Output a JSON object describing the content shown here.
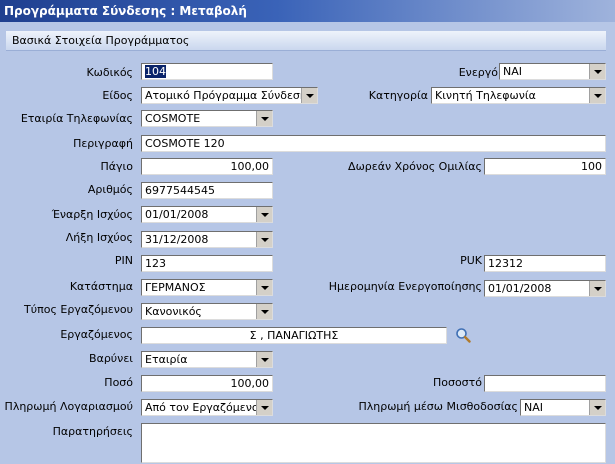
{
  "window": {
    "title": "Προγράμματα Σύνδεσης : Μεταβολή"
  },
  "section": {
    "title": "Βασικά Στοιχεία Προγράμματος"
  },
  "form": {
    "code": {
      "label": "Κωδικός",
      "value": "104"
    },
    "active": {
      "label": "Ενεργό",
      "value": "ΝΑΙ"
    },
    "type": {
      "label": "Είδος",
      "value": "Ατομικό Πρόγραμμα Σύνδεσης"
    },
    "category": {
      "label": "Κατηγορία",
      "value": "Κινητή Τηλεφωνία"
    },
    "company": {
      "label": "Εταιρία Τηλεφωνίας",
      "value": "COSMOTE"
    },
    "description": {
      "label": "Περιγραφή",
      "value": "COSMOTE 120"
    },
    "fee": {
      "label": "Πάγιο",
      "value": "100,00"
    },
    "free_talk": {
      "label": "Δωρεάν Χρόνος Ομιλίας",
      "value": "100"
    },
    "number": {
      "label": "Αριθμός",
      "value": "6977544545"
    },
    "start": {
      "label": "Έναρξη Ισχύος",
      "value": "01/01/2008"
    },
    "end": {
      "label": "Λήξη Ισχύος",
      "value": "31/12/2008"
    },
    "pin": {
      "label": "PIN",
      "value": "123"
    },
    "puk": {
      "label": "PUK",
      "value": "12312"
    },
    "store": {
      "label": "Κατάστημα",
      "value": "ΓΕΡΜΑΝΟΣ"
    },
    "activation_date": {
      "label": "Ημερομηνία Ενεργοποίησης",
      "value": "01/01/2008"
    },
    "employee_type": {
      "label": "Τύπος Εργαζόμενου",
      "value": "Κανονικός"
    },
    "employee": {
      "label": "Εργαζόμενος",
      "value": "Σ , ΠΑΝΑΓΙΩΤΗΣ"
    },
    "charged_to": {
      "label": "Βαρύνει",
      "value": "Εταιρία"
    },
    "amount": {
      "label": "Ποσό",
      "value": "100,00"
    },
    "percent": {
      "label": "Ποσοστό",
      "value": ""
    },
    "payment": {
      "label": "Πληρωμή Λογαριασμού",
      "value": "Από τον Εργαζόμενο"
    },
    "payroll": {
      "label": "Πληρωμή μέσω Μισθοδοσίας",
      "value": "ΝΑΙ"
    },
    "notes": {
      "label": "Παρατηρήσεις",
      "value": ""
    }
  },
  "icons": {
    "search": "magnifier-icon"
  }
}
